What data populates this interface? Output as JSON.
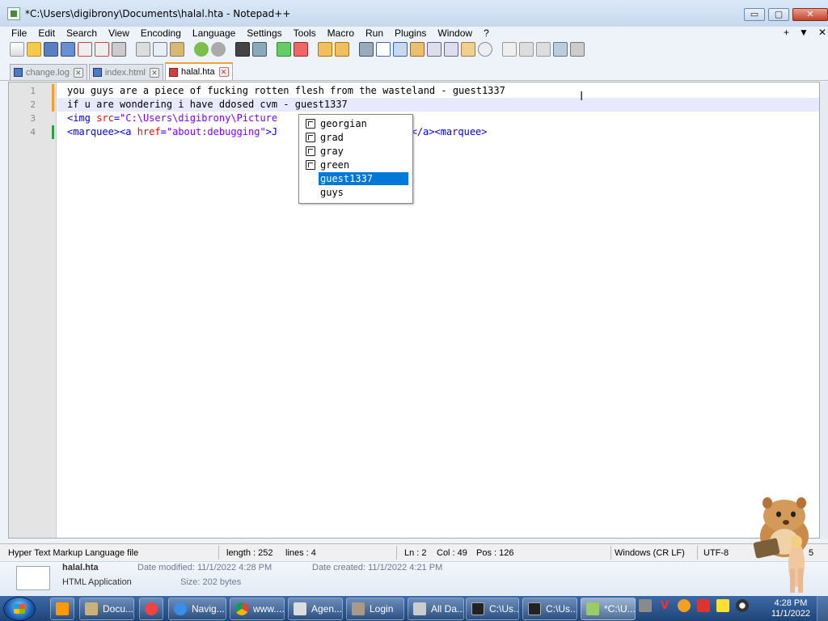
{
  "window": {
    "title": "*C:\\Users\\digibrony\\Documents\\halal.hta - Notepad++",
    "min": "▭",
    "max": "▢",
    "close": "✕"
  },
  "menu": {
    "items": [
      "File",
      "Edit",
      "Search",
      "View",
      "Encoding",
      "Language",
      "Settings",
      "Tools",
      "Macro",
      "Run",
      "Plugins",
      "Window",
      "?"
    ],
    "right": [
      "+",
      "▼",
      "✕"
    ]
  },
  "tabs": [
    {
      "label": "change.log",
      "active": false
    },
    {
      "label": "index.html",
      "active": false
    },
    {
      "label": "halal.hta",
      "active": true
    }
  ],
  "editor": {
    "line_numbers": [
      "1",
      "2",
      "3",
      "4"
    ],
    "lines": {
      "l1": "you guys are a piece of fucking rotten flesh from the wasteland - guest1337",
      "l2": "if u are wondering i have ddosed cvm - guest1337",
      "l3_tag_open": "<img ",
      "l3_attr": "src",
      "l3_eq": "=",
      "l3_str": "\"C:\\Users\\digibrony\\Picture",
      "l3_tail": ">",
      "l4_tag1": "<marquee><a ",
      "l4_attr": "href",
      "l4_eq": "=",
      "l4_str": "\"about:debugging\"",
      "l4_tag2": ">J",
      "l4_text": "!!",
      "l4_tag3": "</a><marquee>"
    }
  },
  "autocomplete": {
    "items": [
      "georgian",
      "grad",
      "gray",
      "green",
      "guest1337",
      "guys"
    ],
    "selected": "guest1337"
  },
  "status": {
    "file_type": "Hyper Text Markup Language file",
    "length": "length : 252",
    "lines": "lines : 4",
    "ln": "Ln : 2",
    "col": "Col : 49",
    "pos": "Pos : 126",
    "eol": "Windows (CR LF)",
    "encoding": "UTF-8",
    "mode": "5"
  },
  "explorer": {
    "file_name": "halal.hta",
    "file_type": "HTML Application",
    "date_modified": "Date modified: 11/1/2022 4:28 PM",
    "date_created": "Date created: 11/1/2022 4:21 PM",
    "size": "Size: 202 bytes"
  },
  "taskbar": {
    "buttons": [
      "Docu...",
      "Navig...",
      "www....",
      "Agen...",
      "Login",
      "All Da...",
      "C:\\Us...",
      "C:\\Us...",
      "*C:\\U..."
    ],
    "clock_time": "4:28 PM",
    "clock_date": "11/1/2022",
    "tray_v": "V"
  },
  "colors": {
    "tag": "#0000ff",
    "attr": "#ff0000",
    "string": "#8000ff",
    "selection": "#0078d7",
    "current_line": "#e8e8ff",
    "modified_mark": "#f0a030",
    "saved_mark": "#2ea043"
  }
}
